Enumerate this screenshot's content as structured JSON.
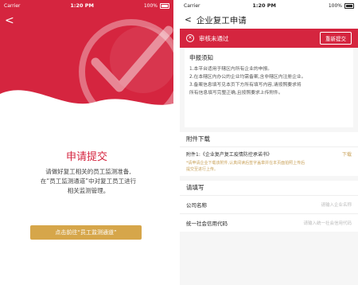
{
  "status_bar": {
    "carrier": "Carrier",
    "time": "1:20 PM",
    "battery": "100%"
  },
  "left": {
    "back": "<",
    "title": "申请提交",
    "desc_lines": [
      "请做好复工相关的员工监测准备,",
      "在“员工监测通道”中对复工员工进行",
      "相关监测管理。"
    ],
    "button": "点击前往“员工监测通道”",
    "colors": {
      "brand": "#d5253f",
      "gold": "#d6a64a"
    }
  },
  "right": {
    "nav_back": "<",
    "nav_title": "企业复工申请",
    "banner": {
      "status": "审核未通过",
      "resubmit": "重新提交"
    },
    "notice": {
      "title": "申报须知",
      "items": [
        "1.本平台适用于辖区内所有企业的申报。",
        "2.在本辖区内办公的企业均需备案,含非辖区内注册企业。",
        "3.备案信息填写见本页下方所有填写内容,请按照要求将",
        "所有信息填写完整正确,且按照要求上传附件。"
      ]
    },
    "download": {
      "title": "附件下载",
      "file_label": "附件1:《企业复产复工疫情防控承诺书》",
      "file_action": "下载",
      "hint_lines": [
        "*请申请企业下载该附件,认真阅读后签字盖章并在本页面拍照上传后",
        "提交至进行上传。"
      ]
    },
    "form": {
      "title": "请填写",
      "fields": [
        {
          "label": "公司名称",
          "placeholder": "请输入企业名称"
        },
        {
          "label": "统一社会信用代码",
          "placeholder": "请输入统一社会信用代码"
        }
      ]
    }
  }
}
